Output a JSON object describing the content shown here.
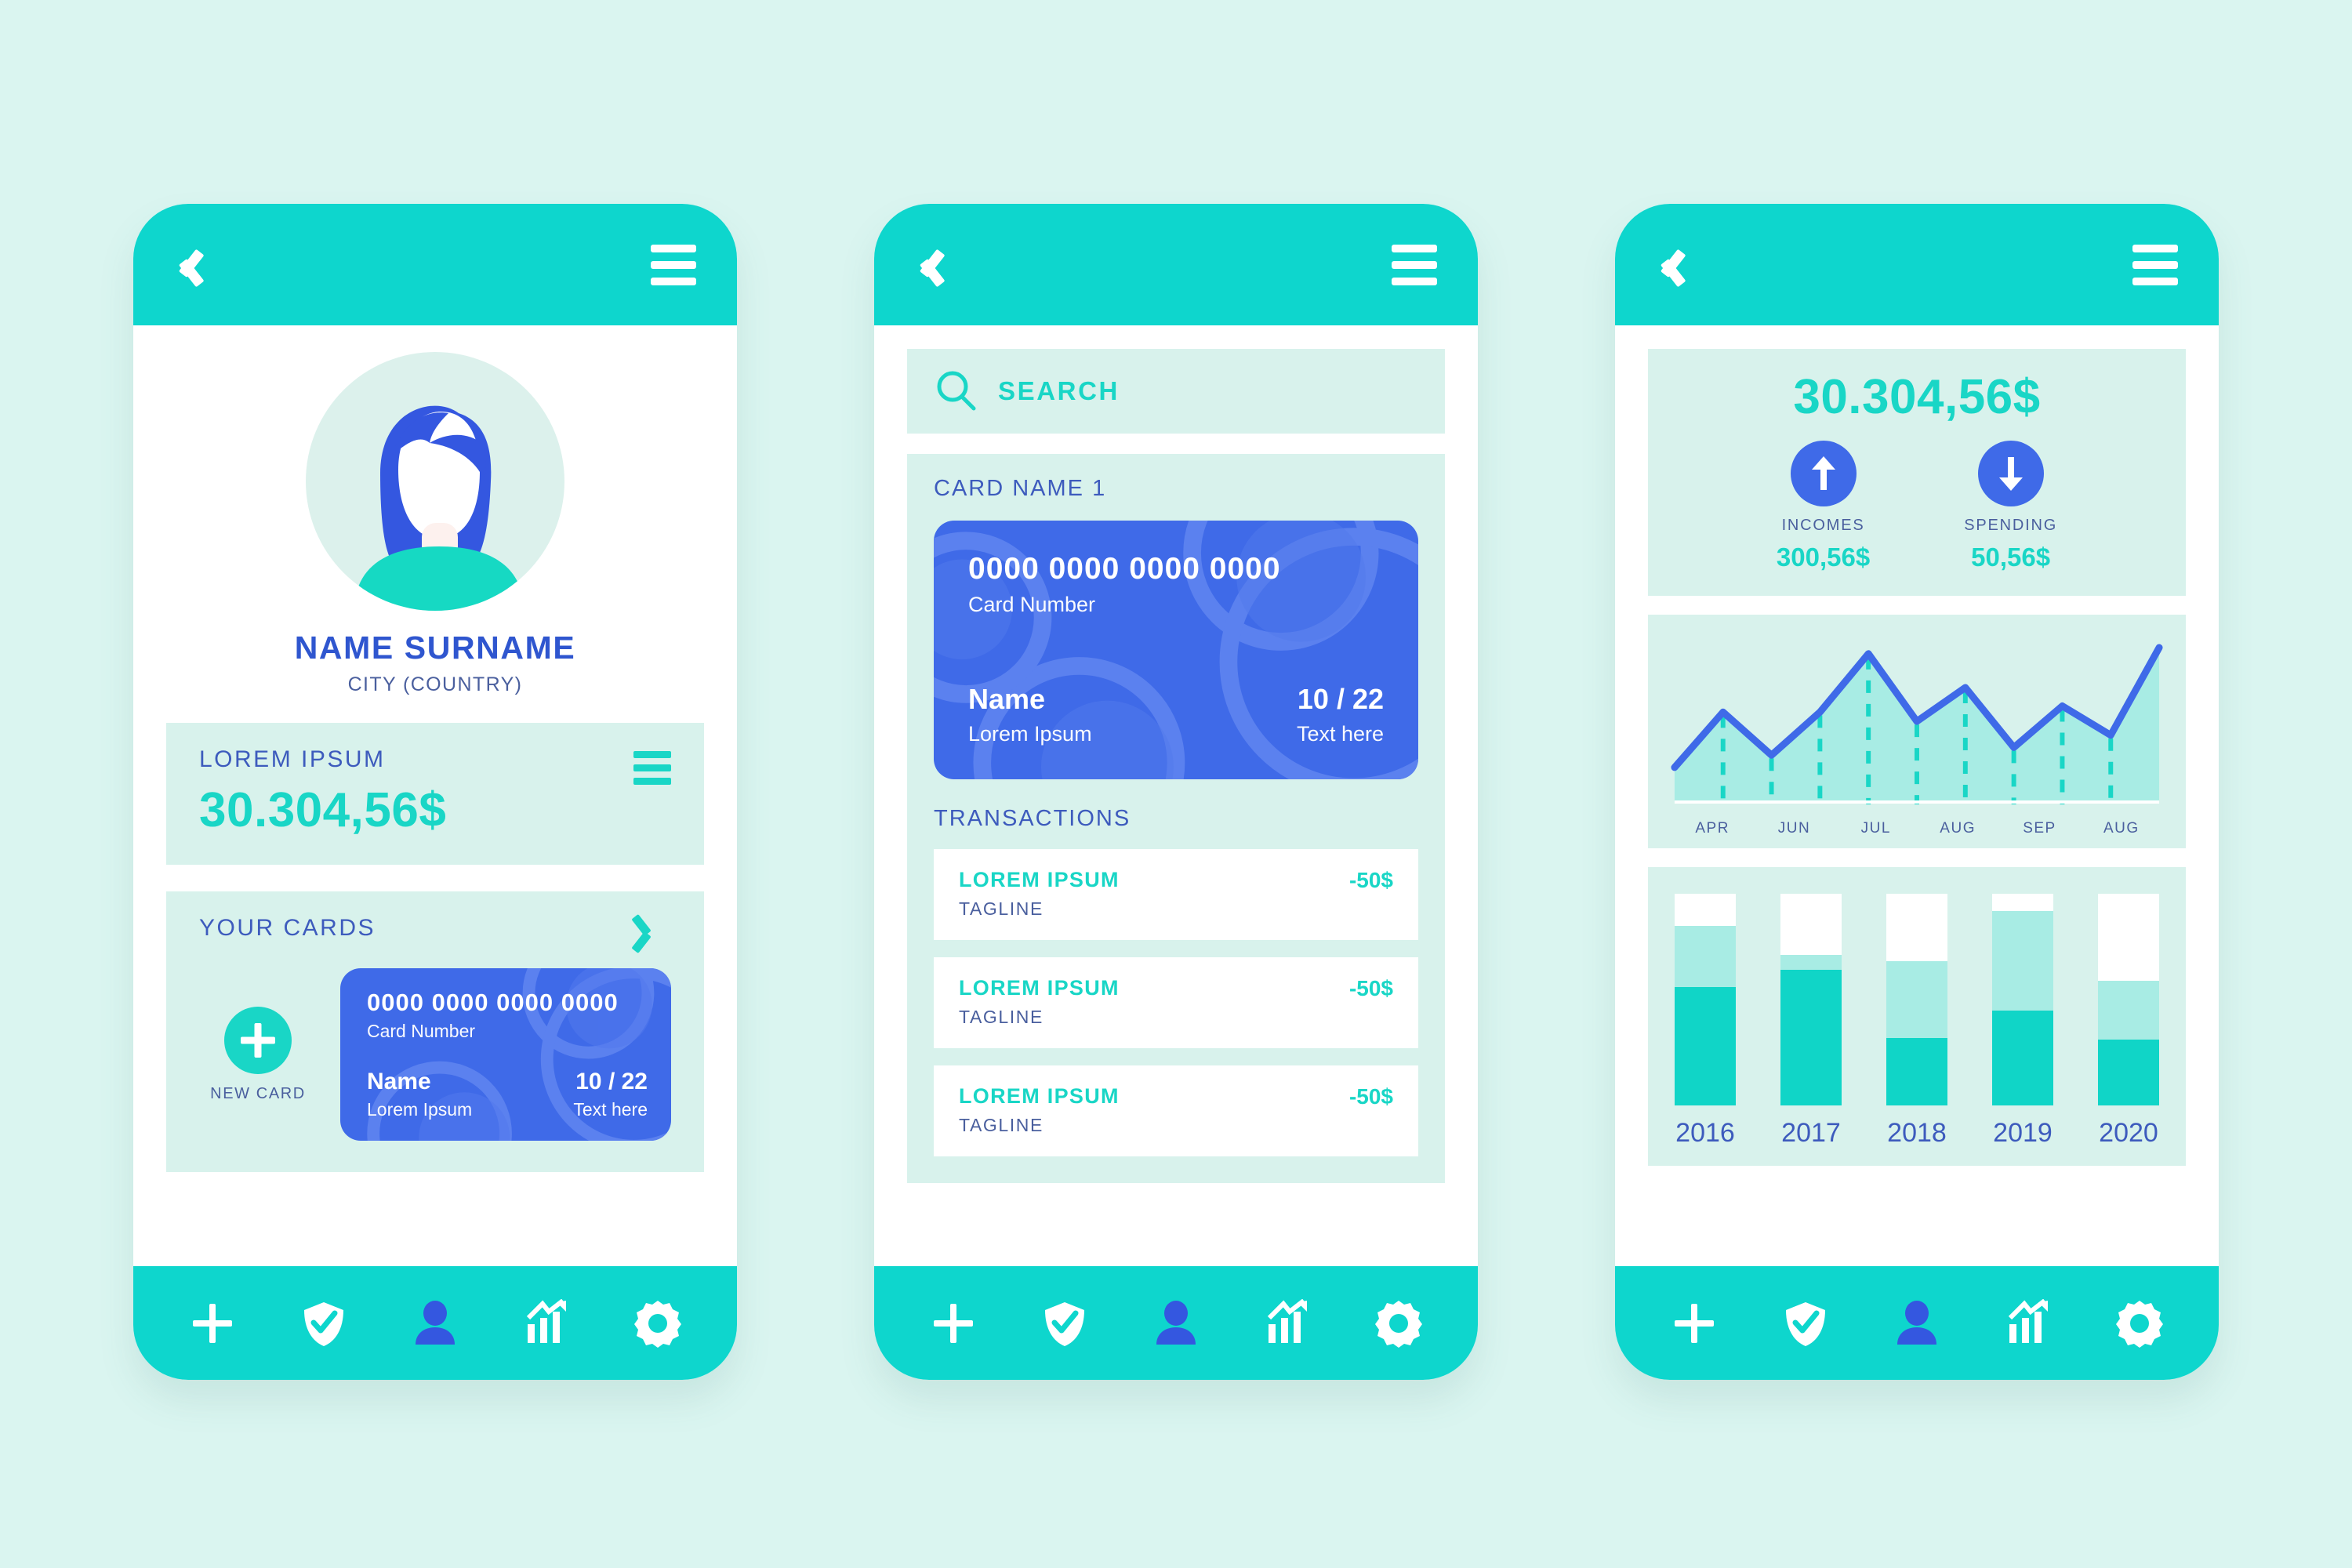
{
  "colors": {
    "page_bg": "#daf5f0",
    "teal": "#19d6c6",
    "teal_header": "#0ed6cd",
    "blue": "#3f6ae8",
    "blue_text": "#3d5bbd",
    "mint_panel": "#d8f2ec",
    "bar_light": "#a8ece4",
    "bar_white": "#ffffff"
  },
  "header": {
    "back_icon": "back-chevron-icon",
    "menu_icon": "hamburger-menu-icon"
  },
  "bottom_nav": {
    "items": [
      {
        "icon": "plus-icon",
        "active": false
      },
      {
        "icon": "shield-check-icon",
        "active": false
      },
      {
        "icon": "person-icon",
        "active": true
      },
      {
        "icon": "bar-chart-arrow-icon",
        "active": false
      },
      {
        "icon": "gear-icon",
        "active": false
      }
    ]
  },
  "screen1": {
    "avatar": "user-avatar-illustration",
    "name": "NAME SURNAME",
    "city": "CITY (COUNTRY)",
    "balance_label": "LOREM IPSUM",
    "balance_value": "30.304,56$",
    "balance_menu_icon": "hamburger-menu-icon",
    "cards_title": "YOUR CARDS",
    "cards_chevron_icon": "chevron-right-icon",
    "new_card_label": "NEW CARD",
    "new_card_icon": "plus-icon",
    "card": {
      "number": "0000 0000 0000 0000",
      "number_label": "Card Number",
      "name_label": "Name",
      "name_value": "Lorem Ipsum",
      "expiry": "10 / 22",
      "expiry_label": "Text here"
    }
  },
  "screen2": {
    "search": {
      "icon": "search-icon",
      "label": "SEARCH",
      "placeholder": "SEARCH"
    },
    "card_section_title": "CARD NAME 1",
    "card": {
      "number": "0000 0000 0000 0000",
      "number_label": "Card Number",
      "name_label": "Name",
      "name_value": "Lorem Ipsum",
      "expiry": "10 / 22",
      "expiry_label": "Text here"
    },
    "transactions_title": "TRANSACTIONS",
    "transactions": [
      {
        "name": "LOREM IPSUM",
        "tagline": "TAGLINE",
        "amount": "-50$"
      },
      {
        "name": "LOREM IPSUM",
        "tagline": "TAGLINE",
        "amount": "-50$"
      },
      {
        "name": "LOREM IPSUM",
        "tagline": "TAGLINE",
        "amount": "-50$"
      }
    ]
  },
  "screen3": {
    "total": "30.304,56$",
    "incomes": {
      "icon": "arrow-up-icon",
      "label": "INCOMES",
      "value": "300,56$"
    },
    "spending": {
      "icon": "arrow-down-icon",
      "label": "SPENDING",
      "value": "50,56$"
    }
  },
  "chart_data": [
    {
      "type": "area",
      "title": "",
      "xlabel": "",
      "ylabel": "",
      "grid": false,
      "legend": "none",
      "tick_labels": [
        "APR",
        "JUN",
        "JUL",
        "AUG",
        "SEP",
        "AUG"
      ],
      "x": [
        0,
        1,
        2,
        3,
        4,
        5,
        6,
        7,
        8,
        9,
        10
      ],
      "values": [
        22,
        58,
        30,
        58,
        96,
        52,
        74,
        35,
        62,
        43,
        100
      ],
      "ylim": [
        0,
        100
      ],
      "line_color": "#3f6ae8",
      "fill_color": "#a8ece4",
      "marker_drop_lines": true,
      "drop_line_color": "#19d6c6"
    },
    {
      "type": "bar",
      "stacked": true,
      "title": "",
      "xlabel": "",
      "ylabel": "",
      "grid": false,
      "categories": [
        "2016",
        "2017",
        "2018",
        "2019",
        "2020"
      ],
      "series": [
        {
          "name": "dark-teal",
          "color": "#10d5c7",
          "values": [
            56,
            64,
            32,
            45,
            31
          ]
        },
        {
          "name": "light-teal",
          "color": "#a8ece4",
          "values": [
            29,
            7,
            36,
            47,
            28
          ]
        },
        {
          "name": "white",
          "color": "#ffffff",
          "values": [
            15,
            29,
            32,
            8,
            41
          ]
        }
      ],
      "ylim": [
        0,
        100
      ]
    }
  ]
}
